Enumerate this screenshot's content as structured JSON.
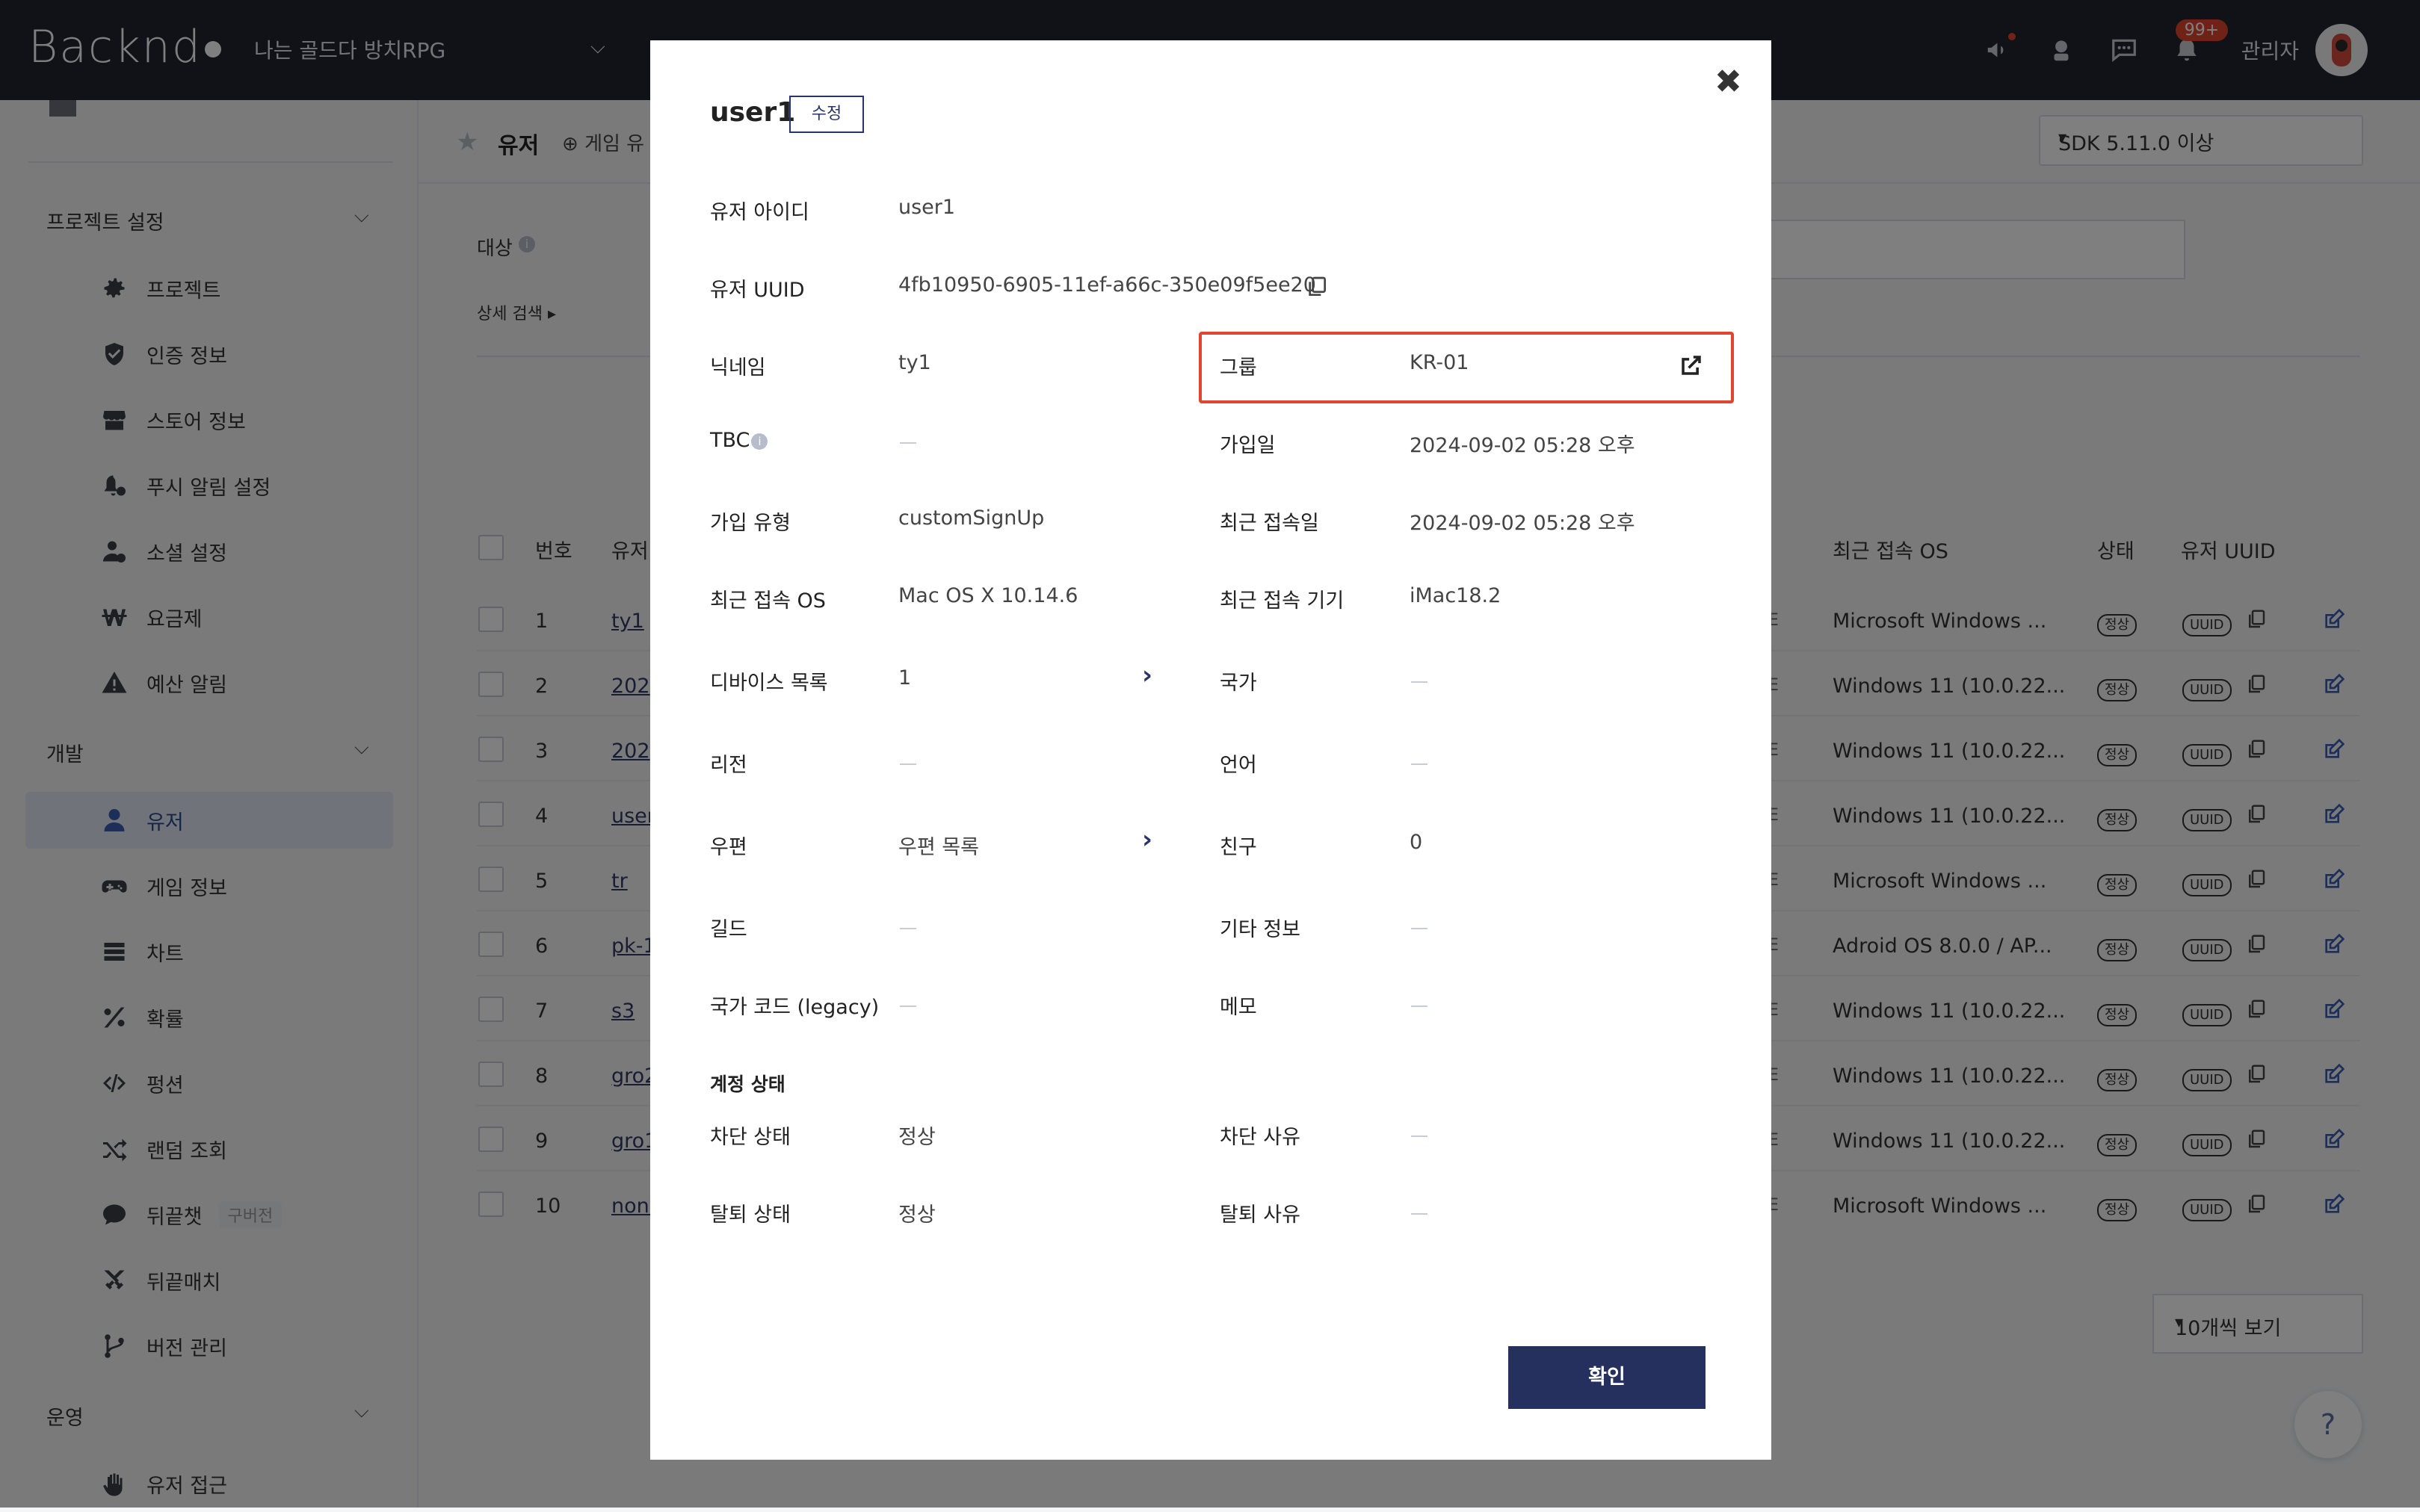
{
  "topbar": {
    "logo": "Backnd",
    "project_name": "나는 골드다 방치RPG",
    "notification_badge": "99+",
    "admin_label": "관리자"
  },
  "sidebar": {
    "sections": [
      {
        "label": "프로젝트 설정",
        "items": [
          {
            "label": "프로젝트",
            "icon": "gear-icon"
          },
          {
            "label": "인증 정보",
            "icon": "shield-icon"
          },
          {
            "label": "스토어 정보",
            "icon": "store-icon"
          },
          {
            "label": "푸시 알림 설정",
            "icon": "bell-settings-icon"
          },
          {
            "label": "소셜 설정",
            "icon": "social-user-icon"
          },
          {
            "label": "요금제",
            "icon": "won-icon"
          },
          {
            "label": "예산 알림",
            "icon": "warning-icon"
          }
        ]
      },
      {
        "label": "개발",
        "items": [
          {
            "label": "유저",
            "icon": "user-icon",
            "active": true
          },
          {
            "label": "게임 정보",
            "icon": "gamepad-icon"
          },
          {
            "label": "차트",
            "icon": "chart-list-icon"
          },
          {
            "label": "확률",
            "icon": "percent-icon"
          },
          {
            "label": "펑션",
            "icon": "code-icon"
          },
          {
            "label": "랜덤 조회",
            "icon": "shuffle-icon"
          },
          {
            "label": "뒤끝챗",
            "icon": "chat-icon",
            "tag": "구버전"
          },
          {
            "label": "뒤끝매치",
            "icon": "swords-icon"
          },
          {
            "label": "버전 관리",
            "icon": "branch-icon"
          }
        ]
      },
      {
        "label": "운영",
        "items": [
          {
            "label": "유저 접근",
            "icon": "hand-icon"
          }
        ]
      }
    ]
  },
  "main": {
    "title": "유저",
    "add_button": "게임 유",
    "sdk_select": "SDK 5.11.0 이상",
    "target_label": "대상",
    "advanced_search": "상세 검색",
    "table": {
      "headers": [
        "번호",
        "유저",
        "최근 접속 OS",
        "상태",
        "유저 UUID"
      ],
      "status_pill": "정상",
      "uuid_pill": "UUID",
      "rows": [
        {
          "num": "1",
          "user": "ty1",
          "tail": "E",
          "os": "Microsoft Windows ..."
        },
        {
          "num": "2",
          "user": "202",
          "tail": "E",
          "os": "Windows 11 (10.0.22..."
        },
        {
          "num": "3",
          "user": "202",
          "tail": "E",
          "os": "Windows 11 (10.0.22..."
        },
        {
          "num": "4",
          "user": "user",
          "tail": "E",
          "os": "Windows 11 (10.0.22..."
        },
        {
          "num": "5",
          "user": "tr",
          "tail": "E",
          "os": "Microsoft Windows ..."
        },
        {
          "num": "6",
          "user": "pk-1",
          "tail": "E",
          "os": "Adroid OS 8.0.0 / AP..."
        },
        {
          "num": "7",
          "user": "s3",
          "tail": "E",
          "os": "Windows 11 (10.0.22..."
        },
        {
          "num": "8",
          "user": "gro2",
          "tail": "E",
          "os": "Windows 11 (10.0.22..."
        },
        {
          "num": "9",
          "user": "gro1",
          "tail": "E",
          "os": "Windows 11 (10.0.22..."
        },
        {
          "num": "10",
          "user": "none",
          "tail": "E",
          "os": "Microsoft Windows ..."
        }
      ]
    },
    "page_size": "10개씩 보기",
    "help": "?"
  },
  "modal": {
    "title": "user1",
    "edit_label": "수정",
    "close_glyph": "✖",
    "user_id_label": "유저 아이디",
    "user_id": "user1",
    "uuid_label": "유저 UUID",
    "uuid": "4fb10950-6905-11ef-a66c-350e09f5ee20",
    "nickname_label": "닉네임",
    "nickname": "ty1",
    "group_label": "그룹",
    "group": "KR-01",
    "tbc_label": "TBC",
    "tbc_info": "i",
    "join_date_label": "가입일",
    "join_date": "2024-09-02 05:28 오후",
    "signup_type_label": "가입 유형",
    "signup_type": "customSignUp",
    "last_access_label": "최근 접속일",
    "last_access": "2024-09-02 05:28 오후",
    "last_os_label": "최근 접속 OS",
    "last_os": "Mac OS X 10.14.6",
    "last_device_label": "최근 접속 기기",
    "last_device": "iMac18.2",
    "devices_label": "디바이스 목록",
    "devices": "1",
    "country_label": "국가",
    "region_label": "리전",
    "language_label": "언어",
    "mail_label": "우편",
    "mail": "우편 목록",
    "friends_label": "친구",
    "friends": "0",
    "guild_label": "길드",
    "etc_label": "기타 정보",
    "country_code_label": "국가 코드 (legacy)",
    "memo_label": "메모",
    "account_status_section": "계정 상태",
    "block_status_label": "차단 상태",
    "block_status": "정상",
    "block_reason_label": "차단 사유",
    "withdraw_status_label": "탈퇴 상태",
    "withdraw_status": "정상",
    "withdraw_reason_label": "탈퇴 사유",
    "confirm_label": "확인"
  },
  "colors": {
    "topbar": "#20242f",
    "accent_navy": "#25305e",
    "highlight_red": "#e0452f"
  }
}
